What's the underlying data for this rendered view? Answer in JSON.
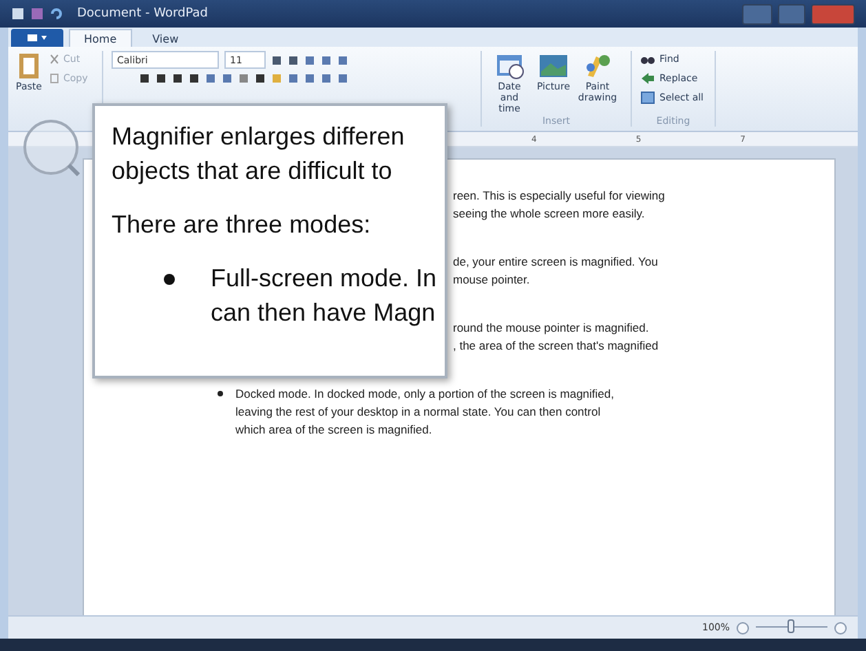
{
  "window": {
    "title": "Document - WordPad"
  },
  "tabs": [
    {
      "label": "Home",
      "selected": true
    },
    {
      "label": "View",
      "selected": false
    }
  ],
  "ribbon": {
    "clipboard": {
      "paste": "Paste",
      "cut": "Cut",
      "copy": "Copy"
    },
    "font": {
      "family": "Calibri",
      "size": "11"
    },
    "insert": {
      "label": "Insert",
      "buttons": [
        "Date and time",
        "Picture",
        "Paint drawing"
      ]
    },
    "editing": {
      "label": "Editing",
      "buttons": [
        "Find",
        "Replace",
        "Select all"
      ]
    }
  },
  "ruler": {
    "numbers": [
      "4",
      "5",
      "7"
    ]
  },
  "document": {
    "paragraphs": [
      {
        "kind": "fragment",
        "lines": [
          "reen. This is especially useful for viewing",
          "seeing the whole screen more easily."
        ]
      },
      {
        "kind": "fragment",
        "lines": [
          "de, your entire screen is magnified. You",
          "mouse pointer."
        ]
      },
      {
        "kind": "fragment",
        "lines": [
          "round the mouse pointer is magnified.",
          ", the area of the screen that's magnified"
        ]
      },
      {
        "kind": "bullet",
        "lines": [
          "Docked mode. In docked mode, only a portion of the screen is magnified,",
          "leaving the rest of your desktop in a normal state. You can then control",
          "which area of the screen is magnified."
        ]
      }
    ]
  },
  "magnifier": {
    "paragraphs": [
      {
        "kind": "text",
        "lines": [
          "Magnifier enlarges differen",
          "objects that are difficult to"
        ]
      },
      {
        "kind": "text",
        "lines": [
          "There are three modes:"
        ]
      },
      {
        "kind": "bullet",
        "lines": [
          "Full-screen mode. In",
          "can then have Magn"
        ]
      }
    ]
  },
  "status_bar": {
    "zoom": "100%",
    "level": 0.5
  }
}
